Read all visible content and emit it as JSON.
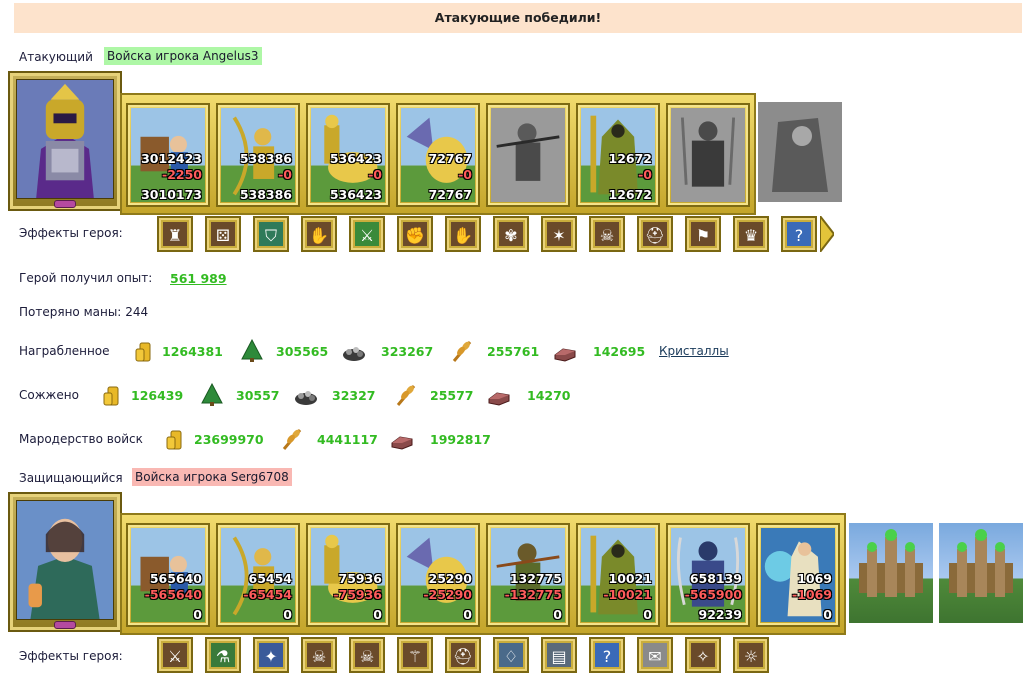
{
  "banner": "Атакующие победили!",
  "attacker": {
    "label": "Атакующий",
    "player": "Войска игрока Angelus3",
    "units": [
      {
        "name": "peasant-cart",
        "n1": "3012423",
        "n2": "-2250",
        "n3": "3010173"
      },
      {
        "name": "archer",
        "n1": "538386",
        "n2": "-0",
        "n3": "538386"
      },
      {
        "name": "knight-rider",
        "n1": "536423",
        "n2": "-0",
        "n3": "536423"
      },
      {
        "name": "pegasus",
        "n1": "72767",
        "n2": "-0",
        "n3": "72767"
      },
      {
        "name": "crossbowman-gray",
        "n1": "",
        "n2": "",
        "n3": ""
      },
      {
        "name": "priest",
        "n1": "12672",
        "n2": "-0",
        "n3": "12672"
      },
      {
        "name": "warrior-gray",
        "n1": "",
        "n2": "",
        "n3": ""
      }
    ],
    "extra_slot": "gray-monk",
    "effects_label": "Эффекты героя:",
    "effects": [
      "fortress-icon",
      "dice-icon",
      "shield-icon",
      "hand-shield-icon",
      "sword-icon",
      "handshake-icon",
      "hand-magic-icon",
      "shell-icon",
      "torch-gold-icon",
      "skull-gold-icon",
      "helmet-gold-icon",
      "banner-icon",
      "treasure-icon",
      "question-icon"
    ],
    "xp_label": "Герой получил опыт:",
    "xp_value": "561 989",
    "mana_label": "Потеряно маны:",
    "mana_value": "244"
  },
  "plundered": {
    "label": "Награбленное",
    "items": [
      {
        "icon": "gold-icon",
        "value": "1264381"
      },
      {
        "icon": "wood-icon",
        "value": "305565"
      },
      {
        "icon": "ore-icon",
        "value": "323267"
      },
      {
        "icon": "wheat-icon",
        "value": "255761"
      },
      {
        "icon": "stone-icon",
        "value": "142695"
      }
    ],
    "link": "Кристаллы"
  },
  "burned": {
    "label": "Сожжено",
    "items": [
      {
        "icon": "gold-icon",
        "value": "126439"
      },
      {
        "icon": "wood-icon",
        "value": "30557"
      },
      {
        "icon": "ore-icon",
        "value": "32327"
      },
      {
        "icon": "wheat-icon",
        "value": "25577"
      },
      {
        "icon": "stone-icon",
        "value": "14270"
      }
    ]
  },
  "looting": {
    "label": "Мародерство войск",
    "items": [
      {
        "icon": "gold-icon",
        "value": "23699970"
      },
      {
        "icon": "wheat-icon",
        "value": "4441117"
      },
      {
        "icon": "stone-icon",
        "value": "1992817"
      }
    ]
  },
  "defender": {
    "label": "Защищающийся",
    "player": "Войска игрока Serg6708",
    "units": [
      {
        "name": "peasant-cart",
        "n1": "565640",
        "n2": "-565640",
        "n3": "0"
      },
      {
        "name": "archer",
        "n1": "65454",
        "n2": "-65454",
        "n3": "0"
      },
      {
        "name": "knight-rider",
        "n1": "75936",
        "n2": "-75936",
        "n3": "0"
      },
      {
        "name": "pegasus",
        "n1": "25290",
        "n2": "-25290",
        "n3": "0"
      },
      {
        "name": "crossbowman",
        "n1": "132775",
        "n2": "-132775",
        "n3": "0"
      },
      {
        "name": "priest",
        "n1": "10021",
        "n2": "-10021",
        "n3": "0"
      },
      {
        "name": "swordsman",
        "n1": "658139",
        "n2": "-565900",
        "n3": "92239"
      },
      {
        "name": "mage",
        "n1": "1069",
        "n2": "-1069",
        "n3": "0"
      }
    ],
    "towers": [
      "tower-1",
      "tower-2"
    ],
    "effects_label": "Эффекты героя:",
    "effects": [
      "sword-gold-icon",
      "potion-icon",
      "crystal-icon",
      "skull-icon",
      "skull-ball-icon",
      "staff-icon",
      "helmet-icon",
      "amulet-icon",
      "armor-icon",
      "question-icon",
      "scroll-icon",
      "wand-icon",
      "sun-shield-icon"
    ]
  }
}
